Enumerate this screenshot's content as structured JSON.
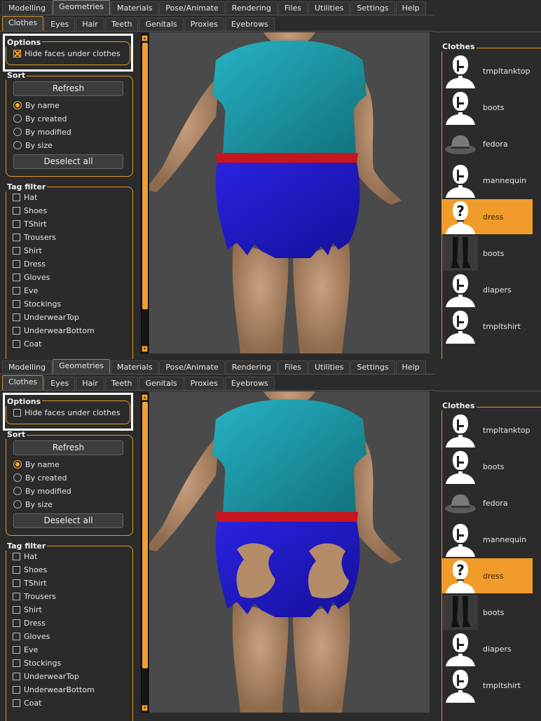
{
  "main_tabs": [
    "Modelling",
    "Geometries",
    "Materials",
    "Pose/Animate",
    "Rendering",
    "Files",
    "Utilities",
    "Settings",
    "Help"
  ],
  "active_main_tab": "Geometries",
  "sub_tabs": [
    "Clothes",
    "Eyes",
    "Hair",
    "Teeth",
    "Genitals",
    "Proxies",
    "Eyebrows"
  ],
  "active_sub_tab": "Clothes",
  "options": {
    "title": "Options",
    "hide_faces_label": "Hide faces under clothes"
  },
  "sort": {
    "title": "Sort",
    "refresh_label": "Refresh",
    "radios": [
      "By name",
      "By created",
      "By modified",
      "By size"
    ],
    "selected": "By name",
    "deselect_label": "Deselect all"
  },
  "tag_filter": {
    "title": "Tag filter",
    "tags": [
      "Hat",
      "Shoes",
      "TShirt",
      "Trousers",
      "Shirt",
      "Dress",
      "Gloves",
      "Eve",
      "Stockings",
      "UnderwearTop",
      "UnderwearBottom",
      "Coat"
    ]
  },
  "clothes_panel": {
    "title": "Clothes",
    "items": [
      {
        "name": "tmpltanktop",
        "icon": "mannequin-head-icon"
      },
      {
        "name": "boots",
        "icon": "mannequin-head-icon"
      },
      {
        "name": "fedora",
        "icon": "fedora-hat-icon"
      },
      {
        "name": "mannequin",
        "icon": "mannequin-head-icon"
      },
      {
        "name": "dress",
        "icon": "question-mark-head-icon"
      },
      {
        "name": "boots",
        "icon": "boots-icon"
      },
      {
        "name": "diapers",
        "icon": "mannequin-head-icon"
      },
      {
        "name": "tmpltshirt",
        "icon": "mannequin-head-icon"
      }
    ],
    "selected_index": 4
  },
  "screens": [
    {
      "id": "top",
      "hide_faces_checked": true
    },
    {
      "id": "bottom",
      "hide_faces_checked": false
    }
  ],
  "colors": {
    "accent": "#f19c2a",
    "shirt": "#1b98a8",
    "belt": "#c8161e",
    "skirt": "#2018c8",
    "skin": "#b58c68",
    "viewport_bg": "#4a4a4a"
  }
}
